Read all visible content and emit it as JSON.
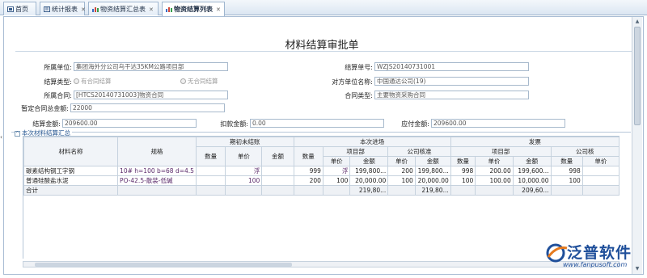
{
  "tabs": [
    {
      "label": "首页",
      "icon": "home-icon"
    },
    {
      "label": "统计报表",
      "icon": "report-icon"
    },
    {
      "label": "物资结算汇总表",
      "icon": "chart-icon"
    },
    {
      "label": "物资结算列表",
      "icon": "chart-icon"
    }
  ],
  "form": {
    "title": "材料结算审批单",
    "org_label": "所属单位:",
    "org_value": "集团海外分公司乌干达35KM公路项目部",
    "settle_no_label": "结算单号:",
    "settle_no_value": "WZJS20140731001",
    "settle_type_label": "结算类型:",
    "settle_type_opt1": "有合同结算",
    "settle_type_opt2": "无合同结算",
    "counterparty_label": "对方单位名称:",
    "counterparty_value": "中国通达公司(19)",
    "contract_label": "所属合同:",
    "contract_value": "[HTCS20140731003]物资合同",
    "contract_type_label": "合同类型:",
    "contract_type_value": "主要物资采购合同",
    "temp_total_label": "暂定合同总金额:",
    "temp_total_value": "22000",
    "settle_amount_label": "结算金额:",
    "settle_amount_value": "209600.00",
    "deduct_label": "扣款金额:",
    "deduct_value": "0.00",
    "payable_label": "应付金额:",
    "payable_value": "209600.00"
  },
  "section": {
    "title": "本次材料结算汇总"
  },
  "grid": {
    "headers": {
      "name": "材料名称",
      "spec": "规格",
      "opening": "期初未结账",
      "current": "本次进场",
      "invoice": "发票",
      "project_dept": "项目部",
      "company_check": "公司核准",
      "invoice_project": "项目部",
      "invoice_company": "公司核",
      "qty": "数量",
      "price": "单价",
      "amount": "金额"
    },
    "rows": [
      {
        "name": "碳素结构钢工字钢",
        "spec": "10# h=100 b=68 d=4.5",
        "open_price": "浮",
        "cur_qty": "999",
        "pd_price": "浮",
        "pd_amount": "199,800...",
        "cc_price": "200",
        "cc_amount": "199,800...",
        "inv_qty": "998",
        "inv_price": "200.00",
        "inv_amount": "199,600...",
        "ic_qty": "998"
      },
      {
        "name": "普通硅酸盐水泥",
        "spec": "PO-42.5-散装-低碱",
        "open_price": "100",
        "cur_qty": "200",
        "pd_price": "100",
        "pd_amount": "20,000.00",
        "cc_price": "100",
        "cc_amount": "20,000.00",
        "inv_qty": "100",
        "inv_price": "100.00",
        "inv_amount": "10,000.00",
        "ic_qty": "100"
      }
    ],
    "total": {
      "label": "合计",
      "pd_amount": "219,80...",
      "cc_amount": "219,80...",
      "inv_amount": "209,60..."
    }
  },
  "logo": {
    "name": "泛普软件",
    "url": "www.fanpusoft.com"
  }
}
